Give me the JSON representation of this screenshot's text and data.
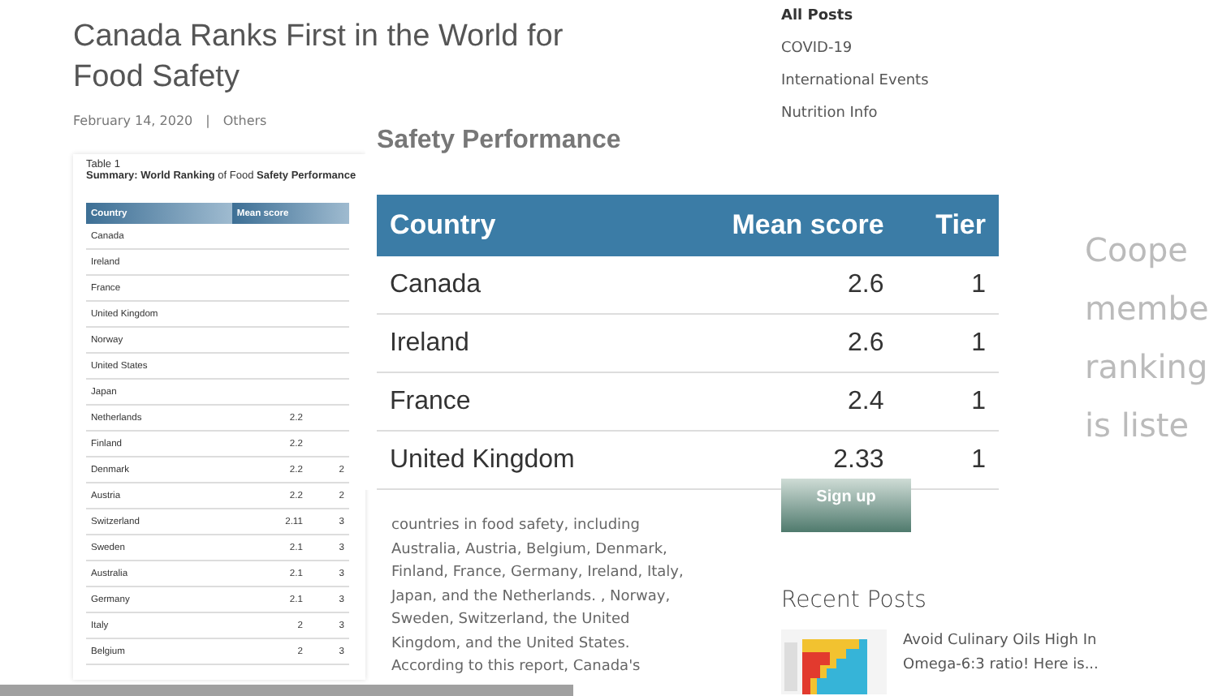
{
  "article": {
    "title": "Canada Ranks First in the World for Food Safety",
    "date": "February 14, 2020",
    "category": "Others",
    "separator": "|",
    "figure": {
      "caption": "Table 1",
      "summary": "**Summary:** **World Ranking** of Food **Safety Performance**",
      "columns": [
        "Country",
        "Mean score"
      ],
      "rows": [
        {
          "country": "Canada"
        },
        {
          "country": "Ireland"
        },
        {
          "country": "France"
        },
        {
          "country": "United Kingdom"
        },
        {
          "country": "Norway"
        },
        {
          "country": "United States"
        },
        {
          "country": "Japan"
        },
        {
          "country": "Netherlands",
          "score": "2.2"
        },
        {
          "country": "Finland",
          "score": "2.2"
        },
        {
          "country": "Denmark",
          "score": "2.2",
          "tier": "2"
        },
        {
          "country": "Austria",
          "score": "2.2",
          "tier": "2"
        },
        {
          "country": "Switzerland",
          "score": "2.11",
          "tier": "3"
        },
        {
          "country": "Sweden",
          "score": "2.1",
          "tier": "3"
        },
        {
          "country": "Australia",
          "score": "2.1",
          "tier": "3"
        },
        {
          "country": "Germany",
          "score": "2.1",
          "tier": "3"
        },
        {
          "country": "Italy",
          "score": "2",
          "tier": "3"
        },
        {
          "country": "Belgium",
          "score": "2",
          "tier": "3"
        }
      ]
    },
    "paragraph": [
      "countries in food safety, including",
      "Australia, Austria, Belgium, Denmark,",
      "Finland, France, Germany, Ireland, Italy,",
      "Japan, and the Netherlands. , Norway,",
      "Sweden, Switzerland, the United",
      "Kingdom, and the United States.",
      "According to this report, Canada's"
    ]
  },
  "zoom_overlay": {
    "heading": "Safety Performance",
    "columns": [
      "Country",
      "Mean score",
      "Tier"
    ],
    "rows": [
      {
        "country": "Canada",
        "score": "2.6",
        "tier": "1"
      },
      {
        "country": "Ireland",
        "score": "2.6",
        "tier": "1"
      },
      {
        "country": "France",
        "score": "2.4",
        "tier": "1"
      },
      {
        "country": "United Kingdom",
        "score": "2.33",
        "tier": "1"
      }
    ],
    "side_text": [
      "Coope",
      "membe",
      "ranking",
      "is liste"
    ]
  },
  "sidebar": {
    "categories": [
      {
        "label": "All Posts",
        "selected": true
      },
      {
        "label": "COVID-19",
        "selected": false
      },
      {
        "label": "International Events",
        "selected": false
      },
      {
        "label": "Nutrition Info",
        "selected": false
      }
    ],
    "signup_button": "Sign up",
    "recent_title": "Recent Posts",
    "recent_posts": [
      {
        "title": "Avoid Culinary Oils High In Omega-6:3 ratio! Here is..."
      }
    ]
  },
  "video_bar": {
    "level": 0.47
  }
}
